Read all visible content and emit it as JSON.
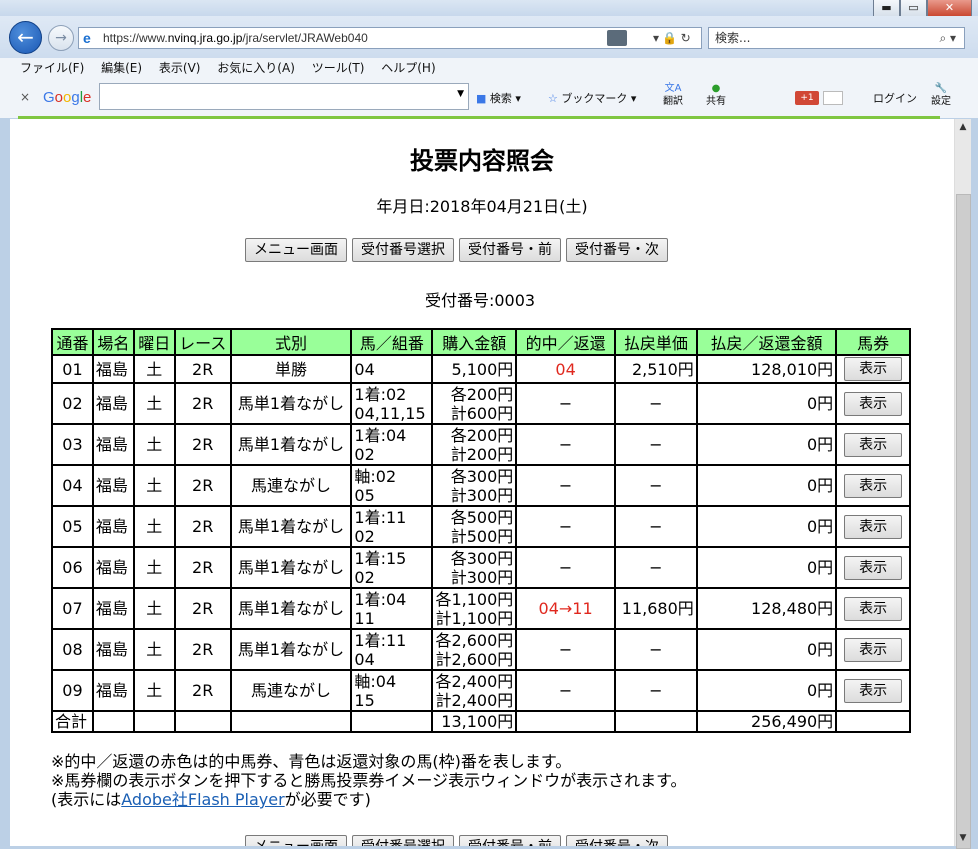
{
  "window": {
    "minimize": "▬",
    "maximize": "▭",
    "close": "✕"
  },
  "address": {
    "url_prefix": "https://www.",
    "url_domain": "nvinq.jra.go.jp",
    "url_path": "/jra/servlet/JRAWeb040",
    "search_placeholder": "検索..."
  },
  "menu": [
    "ファイル(F)",
    "編集(E)",
    "表示(V)",
    "お気に入り(A)",
    "ツール(T)",
    "ヘルプ(H)"
  ],
  "google_toolbar": {
    "logo": "Google",
    "search_label": "検索",
    "bookmark_label": "ブックマーク",
    "translate_label": "翻訳",
    "share_label": "共有",
    "plus_label": "+1",
    "login_label": "ログイン",
    "settings_label": "設定"
  },
  "page": {
    "title": "投票内容照会",
    "date": "年月日:2018年04月21日(土)",
    "receipt": "受付番号:0003"
  },
  "nav_buttons": [
    "メニュー画面",
    "受付番号選択",
    "受付番号・前",
    "受付番号・次"
  ],
  "table": {
    "headers": [
      "通番",
      "場名",
      "曜日",
      "レース",
      "式別",
      "馬／組番",
      "購入金額",
      "的中／返還",
      "払戻単価",
      "払戻／返還金額",
      "馬券"
    ],
    "rows": [
      {
        "no": "01",
        "place": "福島",
        "day": "土",
        "race": "2R",
        "type": "単勝",
        "combo1": "04",
        "combo2": "",
        "amt1": "5,100円",
        "amt2": "",
        "hit": "04",
        "unit": "2,510円",
        "payout": "128,010円",
        "btn": "表示"
      },
      {
        "no": "02",
        "place": "福島",
        "day": "土",
        "race": "2R",
        "type": "馬単1着ながし",
        "combo1": "1着:02",
        "combo2": "04,11,15",
        "amt1": "各200円",
        "amt2": "計600円",
        "hit": "−",
        "unit": "−",
        "payout": "0円",
        "btn": "表示"
      },
      {
        "no": "03",
        "place": "福島",
        "day": "土",
        "race": "2R",
        "type": "馬単1着ながし",
        "combo1": "1着:04",
        "combo2": "02",
        "amt1": "各200円",
        "amt2": "計200円",
        "hit": "−",
        "unit": "−",
        "payout": "0円",
        "btn": "表示"
      },
      {
        "no": "04",
        "place": "福島",
        "day": "土",
        "race": "2R",
        "type": "馬連ながし",
        "combo1": "軸:02",
        "combo2": "05",
        "amt1": "各300円",
        "amt2": "計300円",
        "hit": "−",
        "unit": "−",
        "payout": "0円",
        "btn": "表示"
      },
      {
        "no": "05",
        "place": "福島",
        "day": "土",
        "race": "2R",
        "type": "馬単1着ながし",
        "combo1": "1着:11",
        "combo2": "02",
        "amt1": "各500円",
        "amt2": "計500円",
        "hit": "−",
        "unit": "−",
        "payout": "0円",
        "btn": "表示"
      },
      {
        "no": "06",
        "place": "福島",
        "day": "土",
        "race": "2R",
        "type": "馬単1着ながし",
        "combo1": "1着:15",
        "combo2": "02",
        "amt1": "各300円",
        "amt2": "計300円",
        "hit": "−",
        "unit": "−",
        "payout": "0円",
        "btn": "表示"
      },
      {
        "no": "07",
        "place": "福島",
        "day": "土",
        "race": "2R",
        "type": "馬単1着ながし",
        "combo1": "1着:04",
        "combo2": "11",
        "amt1": "各1,100円",
        "amt2": "計1,100円",
        "hit": "04→11",
        "unit": "11,680円",
        "payout": "128,480円",
        "btn": "表示"
      },
      {
        "no": "08",
        "place": "福島",
        "day": "土",
        "race": "2R",
        "type": "馬単1着ながし",
        "combo1": "1着:11",
        "combo2": "04",
        "amt1": "各2,600円",
        "amt2": "計2,600円",
        "hit": "−",
        "unit": "−",
        "payout": "0円",
        "btn": "表示"
      },
      {
        "no": "09",
        "place": "福島",
        "day": "土",
        "race": "2R",
        "type": "馬連ながし",
        "combo1": "軸:04",
        "combo2": "15",
        "amt1": "各2,400円",
        "amt2": "計2,400円",
        "hit": "−",
        "unit": "−",
        "payout": "0円",
        "btn": "表示"
      }
    ],
    "total": {
      "label": "合計",
      "amount": "13,100円",
      "payout": "256,490円"
    }
  },
  "notes": {
    "line1": "※的中／返還の赤色は的中馬券、青色は返還対象の馬(枠)番を表します。",
    "line2": "※馬券欄の表示ボタンを押下すると勝馬投票券イメージ表示ウィンドウが表示されます。",
    "line3_prefix": "(表示には",
    "line3_link": "Adobe社Flash Player",
    "line3_suffix": "が必要です)"
  },
  "colors": {
    "header_bg": "#99ff99",
    "hit_red": "#e0281e",
    "link_blue": "#1a5fb4"
  }
}
